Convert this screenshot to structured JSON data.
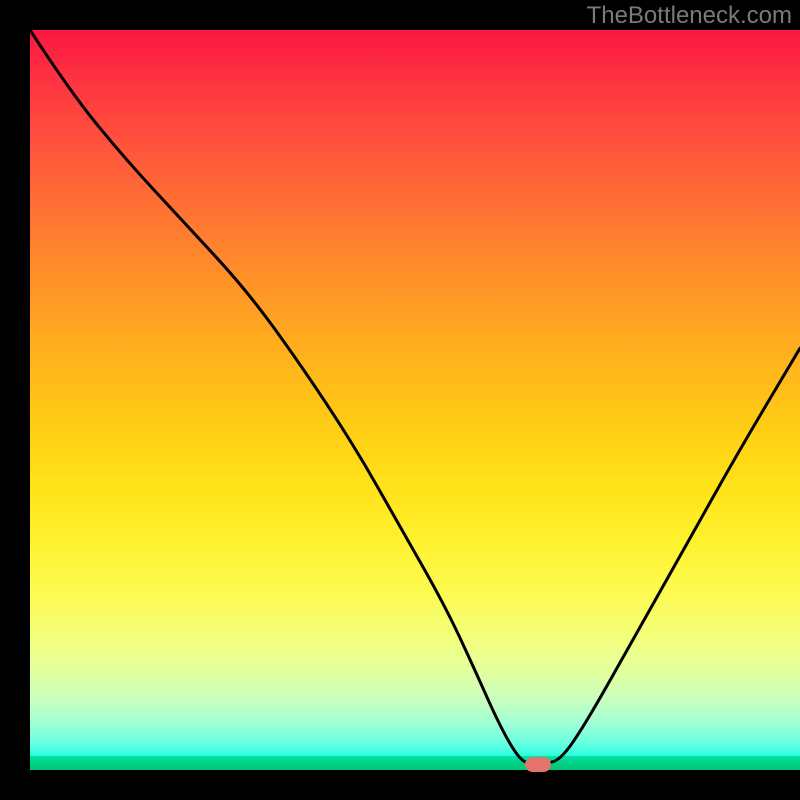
{
  "watermark": "TheBottleneck.com",
  "colors": {
    "curve_stroke": "#000000",
    "marker_fill": "#e4736b",
    "frame": "#000000"
  },
  "chart_data": {
    "type": "line",
    "title": "",
    "xlabel": "",
    "ylabel": "",
    "xlim": [
      0,
      100
    ],
    "ylim": [
      0,
      100
    ],
    "grid": false,
    "legend": false,
    "series": [
      {
        "name": "bottleneck-curve",
        "x": [
          0,
          5,
          12,
          20,
          28,
          35,
          42,
          48,
          54,
          58,
          61,
          63.5,
          65,
          67,
          69,
          72,
          78,
          85,
          92,
          100
        ],
        "values": [
          100,
          92,
          83,
          74,
          65,
          55,
          44,
          33,
          22,
          13,
          6,
          1.5,
          0.8,
          0.8,
          1.5,
          6,
          17,
          30,
          43,
          57
        ]
      }
    ],
    "annotations": [
      {
        "name": "optimal-marker",
        "x": 66,
        "y": 0.8
      }
    ],
    "background_gradient": {
      "orientation": "vertical",
      "stops": [
        {
          "pos": 0.0,
          "color": "#fb1740"
        },
        {
          "pos": 0.5,
          "color": "#ffbd18"
        },
        {
          "pos": 0.8,
          "color": "#f3ff7a"
        },
        {
          "pos": 1.0,
          "color": "#00cd80"
        }
      ]
    }
  }
}
